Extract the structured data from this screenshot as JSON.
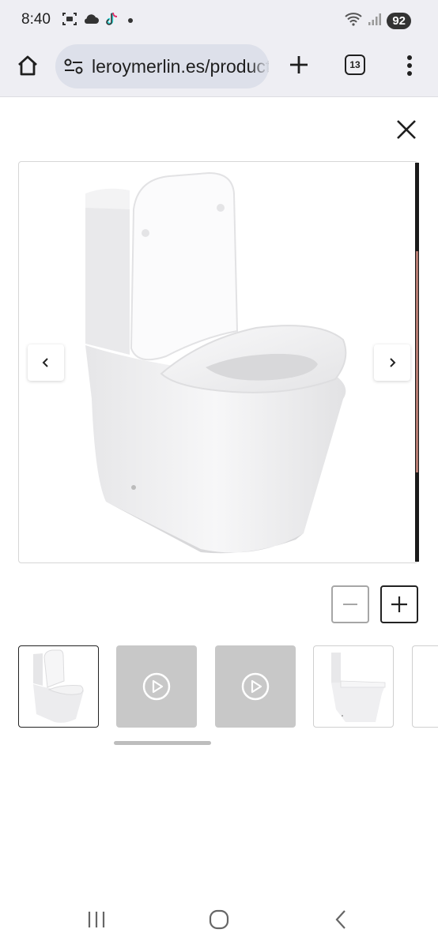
{
  "status_bar": {
    "time": "8:40",
    "battery": "92",
    "icons": [
      "screenshot-icon",
      "cloud-icon",
      "tiktok-icon",
      "notification-dot-icon",
      "wifi-icon",
      "signal-icon"
    ]
  },
  "browser": {
    "url": "leroymerlin.es/producto",
    "tab_count": "13",
    "icons": [
      "home-icon",
      "site-settings-icon",
      "plus-icon",
      "tabs-icon",
      "more-vert-icon"
    ]
  },
  "viewer": {
    "icons": [
      "close-icon",
      "chevron-left-icon",
      "chevron-right-icon",
      "zoom-out-icon",
      "zoom-in-icon"
    ],
    "thumbnails": [
      {
        "type": "image",
        "selected": true
      },
      {
        "type": "video",
        "selected": false
      },
      {
        "type": "video",
        "selected": false
      },
      {
        "type": "image",
        "selected": false
      },
      {
        "type": "image",
        "selected": false
      }
    ]
  },
  "colors": {
    "chrome_bg": "#eeeef3",
    "url_pill": "#dde0ea",
    "video_thumb": "#c8c8c8",
    "text": "#1f1f1f"
  },
  "android_nav": {
    "icons": [
      "recent-apps-icon",
      "home-circle-icon",
      "back-icon"
    ]
  }
}
